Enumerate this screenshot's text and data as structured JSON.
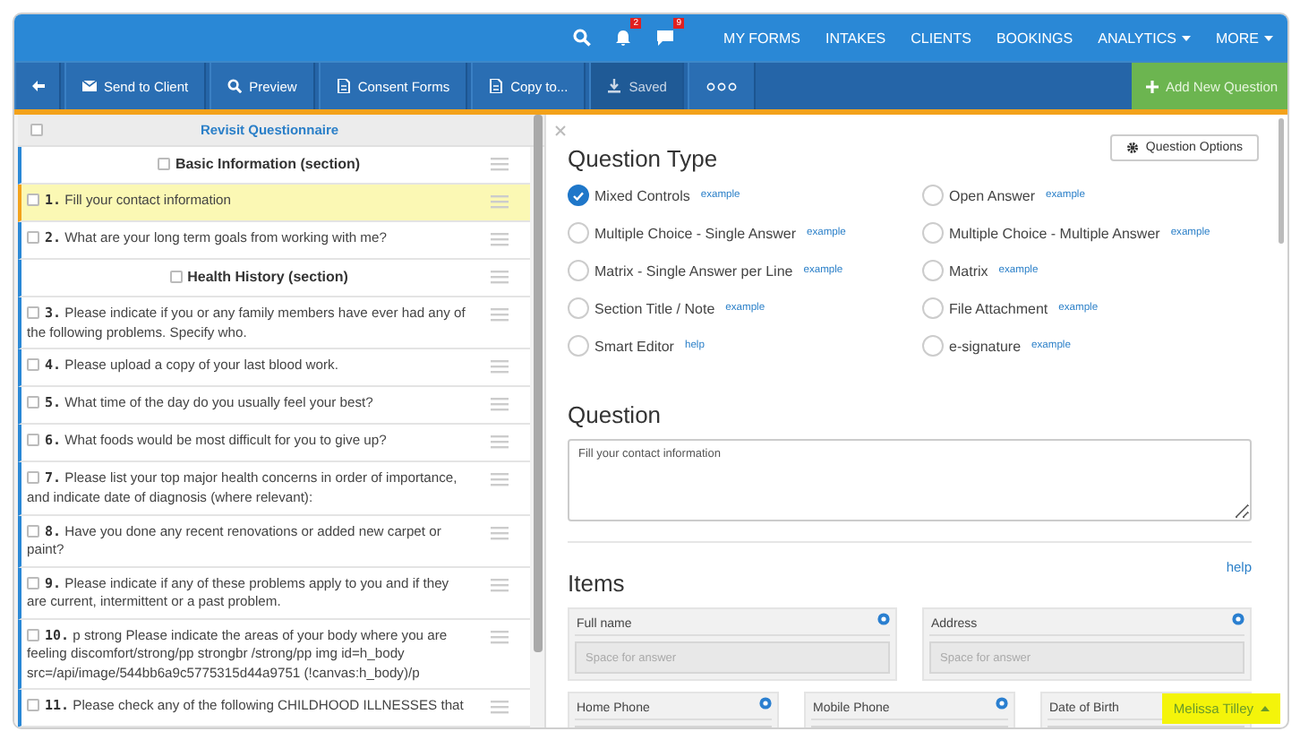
{
  "topbar": {
    "icons": [
      {
        "kind": "search"
      },
      {
        "kind": "bell",
        "badge": "2"
      },
      {
        "kind": "chat",
        "badge": "9"
      }
    ],
    "menu": [
      {
        "label": "MY FORMS",
        "dropdown": false
      },
      {
        "label": "INTAKES",
        "dropdown": false
      },
      {
        "label": "CLIENTS",
        "dropdown": false
      },
      {
        "label": "BOOKINGS",
        "dropdown": false
      },
      {
        "label": "ANALYTICS",
        "dropdown": true
      },
      {
        "label": "MORE",
        "dropdown": true
      }
    ]
  },
  "toolbar": {
    "buttons": [
      {
        "kind": "back",
        "disabled": false
      },
      {
        "kind": "send",
        "label": "Send to Client",
        "disabled": false
      },
      {
        "kind": "preview",
        "label": "Preview",
        "disabled": false
      },
      {
        "kind": "doc",
        "label": "Consent Forms",
        "disabled": false
      },
      {
        "kind": "doc",
        "label": "Copy to...",
        "disabled": false
      },
      {
        "kind": "saved",
        "label": "Saved",
        "disabled": true
      },
      {
        "kind": "more",
        "disabled": false
      }
    ],
    "add_button": "Add New Question"
  },
  "sidebar": {
    "title": "Revisit Questionnaire",
    "checked": false,
    "items": [
      {
        "kind": "section",
        "text": "Basic Information (section)",
        "checked": false,
        "selected": false
      },
      {
        "kind": "question",
        "number": "1.",
        "text": "Fill your contact information",
        "checked": false,
        "selected": true
      },
      {
        "kind": "question",
        "number": "2.",
        "text": "What are your long term goals from working with me?",
        "checked": false,
        "selected": false
      },
      {
        "kind": "section",
        "text": "Health History (section)",
        "checked": false,
        "selected": false
      },
      {
        "kind": "question",
        "number": "3.",
        "text": "Please indicate if you or any family members have ever had any of the following problems. Specify who.",
        "checked": false,
        "selected": false
      },
      {
        "kind": "question",
        "number": "4.",
        "text": "Please upload a copy of your last blood work.",
        "checked": false,
        "selected": false
      },
      {
        "kind": "question",
        "number": "5.",
        "text": "What time of the day do you usually feel your best?",
        "checked": false,
        "selected": false
      },
      {
        "kind": "question",
        "number": "6.",
        "text": "What foods would be most difficult for you to give up?",
        "checked": false,
        "selected": false
      },
      {
        "kind": "question",
        "number": "7.",
        "text": "Please list your top major health concerns in order of importance, and indicate date of diagnosis (where relevant):",
        "checked": false,
        "selected": false
      },
      {
        "kind": "question",
        "number": "8.",
        "text": "Have you done any recent renovations or added new carpet or paint?",
        "checked": false,
        "selected": false
      },
      {
        "kind": "question",
        "number": "9.",
        "text": "Please indicate if any of these problems apply to you and if they are current, intermittent or a past problem.",
        "checked": false,
        "selected": false
      },
      {
        "kind": "question",
        "number": "10.",
        "text": "p strong Please indicate the areas of your body where you are feeling discomfort/strong/pp strongbr /strong/pp img id=h_body src=/api/image/544bb6a9c5775315d44a9751 (!canvas:h_body)/p",
        "checked": false,
        "selected": false
      },
      {
        "kind": "question",
        "number": "11.",
        "text": "Please check any of the following CHILDHOOD ILLNESSES that",
        "checked": false,
        "selected": false
      }
    ]
  },
  "editor": {
    "question_type": {
      "title": "Question Type",
      "options_button": "Question Options",
      "options": [
        {
          "label": "Mixed Controls",
          "link": "example",
          "selected": true
        },
        {
          "label": "Open Answer",
          "link": "example",
          "selected": false
        },
        {
          "label": "Multiple Choice - Single Answer",
          "link": "example",
          "selected": false
        },
        {
          "label": "Multiple Choice - Multiple Answer",
          "link": "example",
          "selected": false
        },
        {
          "label": "Matrix - Single Answer per Line",
          "link": "example",
          "selected": false
        },
        {
          "label": "Matrix",
          "link": "example",
          "selected": false
        },
        {
          "label": "Section Title / Note",
          "link": "example",
          "selected": false
        },
        {
          "label": "File Attachment",
          "link": "example",
          "selected": false
        },
        {
          "label": "Smart Editor",
          "link": "help",
          "selected": false
        },
        {
          "label": "e-signature",
          "link": "example",
          "selected": false
        }
      ]
    },
    "question": {
      "title": "Question",
      "value": "Fill your contact information"
    },
    "items": {
      "title": "Items",
      "help": "help",
      "rows": [
        [
          {
            "label": "Full name",
            "placeholder": "Space for answer"
          },
          {
            "label": "Address",
            "placeholder": "Space for answer"
          }
        ],
        [
          {
            "label": "Home Phone"
          },
          {
            "label": "Mobile Phone"
          },
          {
            "label": "Date of Birth"
          }
        ]
      ]
    }
  },
  "user_badge": "Melissa Tilley"
}
